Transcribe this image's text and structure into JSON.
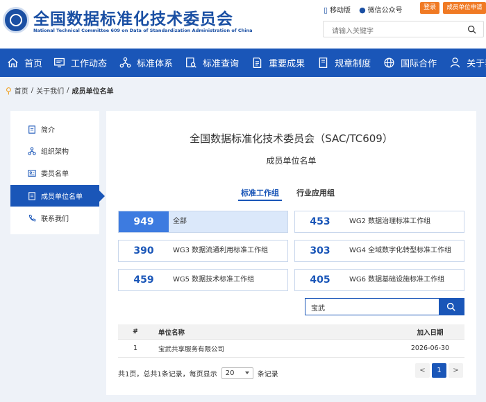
{
  "header": {
    "title": "全国数据标准化技术委员会",
    "subtitle": "National Technical Committee 609 on Data of Standardization Administration of China",
    "mobile_label": "移动版",
    "wechat_label": "微信公众号",
    "login_label": "登录",
    "apply_label": "成员单位申请",
    "search_placeholder": "请输入关键字",
    "accent": "#1a56b8",
    "orange": "#f07a24"
  },
  "nav": [
    {
      "label": "首页",
      "icon": "home-icon"
    },
    {
      "label": "工作动态",
      "icon": "monitor-icon"
    },
    {
      "label": "标准体系",
      "icon": "network-icon"
    },
    {
      "label": "标准查询",
      "icon": "search-doc-icon"
    },
    {
      "label": "重要成果",
      "icon": "document-icon"
    },
    {
      "label": "规章制度",
      "icon": "book-icon"
    },
    {
      "label": "国际合作",
      "icon": "globe-icon"
    },
    {
      "label": "关于我们",
      "icon": "user-icon"
    }
  ],
  "breadcrumb": {
    "home": "首页",
    "sep": "/",
    "parent": "关于我们",
    "current": "成员单位名单"
  },
  "sidebar": [
    {
      "label": "简介",
      "icon": "doc-icon"
    },
    {
      "label": "组织架构",
      "icon": "tree-icon"
    },
    {
      "label": "委员名单",
      "icon": "id-card-icon"
    },
    {
      "label": "成员单位名单",
      "icon": "list-icon"
    },
    {
      "label": "联系我们",
      "icon": "phone-icon"
    }
  ],
  "main": {
    "title": "全国数据标准化技术委员会（SAC/TC609）",
    "subtitle": "成员单位名单",
    "tabs": [
      "标准工作组",
      "行业应用组"
    ],
    "cards": [
      {
        "count": "949",
        "label": "全部"
      },
      {
        "count": "453",
        "label": "WG2 数据治理标准工作组"
      },
      {
        "count": "390",
        "label": "WG3 数据流通利用标准工作组"
      },
      {
        "count": "303",
        "label": "WG4 全域数字化转型标准工作组"
      },
      {
        "count": "459",
        "label": "WG5 数据技术标准工作组"
      },
      {
        "count": "405",
        "label": "WG6 数据基础设施标准工作组"
      }
    ],
    "search_value": "宝武",
    "table": {
      "headers": [
        "#",
        "单位名称",
        "加入日期"
      ],
      "rows": [
        {
          "idx": "1",
          "name": "宝武共享服务有限公司",
          "date": "2026-06-30"
        }
      ]
    },
    "pager": {
      "summary": "共1页，总共1条记录，每页显示",
      "page_size": "20",
      "suffix": "条记录",
      "prev": "<",
      "current": "1",
      "next": ">"
    }
  }
}
